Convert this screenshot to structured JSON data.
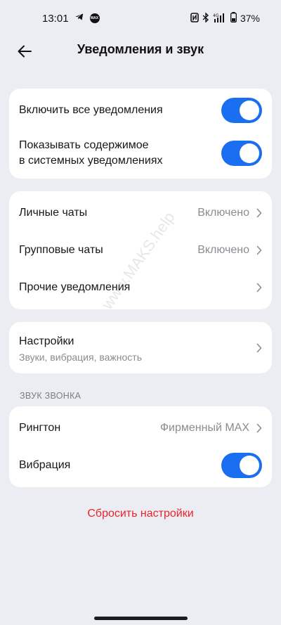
{
  "status_bar": {
    "time": "13:01",
    "battery": "37%",
    "network": "4G"
  },
  "header": {
    "title": "Уведомления и звук"
  },
  "card1": {
    "items": [
      {
        "label": "Включить все уведомления",
        "toggle": true
      },
      {
        "label_line1": "Показывать содержимое",
        "label_line2": "в системных уведомлениях",
        "toggle": true
      }
    ]
  },
  "card2": {
    "items": [
      {
        "label": "Личные чаты",
        "value": "Включено"
      },
      {
        "label": "Групповые чаты",
        "value": "Включено"
      },
      {
        "label": "Прочие уведомления"
      }
    ]
  },
  "card3": {
    "label": "Настройки",
    "subtitle": "Звуки, вибрация, важность"
  },
  "ringtone_section": {
    "header": "ЗВУК ЗВОНКА",
    "items": [
      {
        "label": "Рингтон",
        "value": "Фирменный MAX"
      },
      {
        "label": "Вибрация",
        "toggle": true
      }
    ]
  },
  "reset_label": "Сбросить настройки",
  "watermark": "www.MAKS.help",
  "colors": {
    "accent": "#1a6ff0",
    "danger": "#e8242c",
    "background": "#ecedf2"
  }
}
